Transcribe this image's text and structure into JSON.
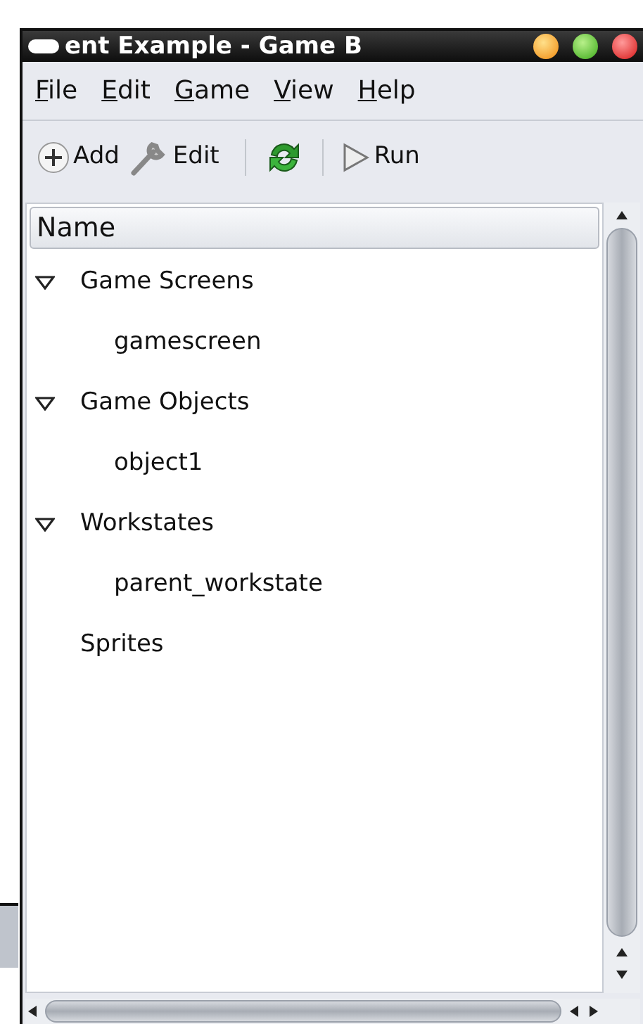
{
  "window": {
    "title": "ent Example - Game B"
  },
  "menu": [
    {
      "label": "File"
    },
    {
      "label": "Edit"
    },
    {
      "label": "Game"
    },
    {
      "label": "View"
    },
    {
      "label": "Help"
    }
  ],
  "toolbar": [
    {
      "kind": "add",
      "label": "Add"
    },
    {
      "kind": "edit",
      "label": "Edit"
    },
    {
      "kind": "separator"
    },
    {
      "kind": "refresh"
    },
    {
      "kind": "separator"
    },
    {
      "kind": "run",
      "label": "Run"
    }
  ],
  "tree": {
    "columns": [
      "Name"
    ],
    "items": [
      {
        "label": "Game Screens",
        "expanded": true,
        "children": [
          {
            "label": "gamescreen"
          }
        ]
      },
      {
        "label": "Game Objects",
        "expanded": true,
        "children": [
          {
            "label": "object1"
          }
        ]
      },
      {
        "label": "Workstates",
        "expanded": true,
        "children": [
          {
            "label": "parent_workstate"
          }
        ]
      },
      {
        "label": "Sprites"
      }
    ]
  }
}
